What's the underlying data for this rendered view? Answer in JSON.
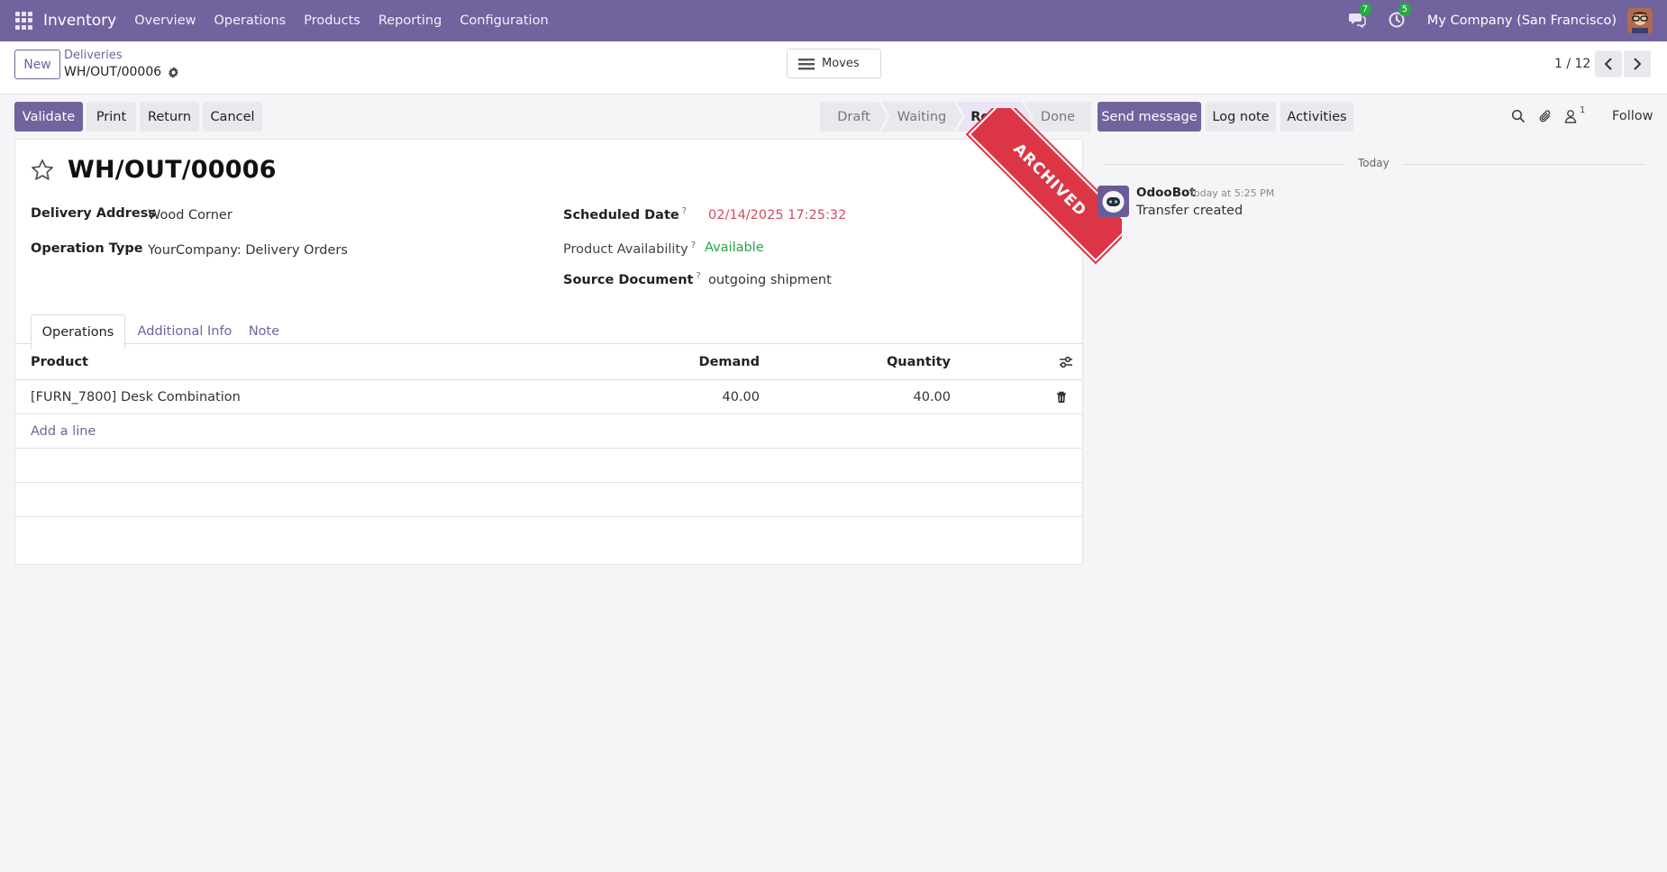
{
  "topbar": {
    "app_name": "Inventory",
    "nav": [
      "Overview",
      "Operations",
      "Products",
      "Reporting",
      "Configuration"
    ],
    "messages_badge": "7",
    "activities_badge": "5",
    "company": "My Company (San Francisco)"
  },
  "control": {
    "new_label": "New",
    "breadcrumb_parent": "Deliveries",
    "breadcrumb_current": "WH/OUT/00006",
    "moves_label": "Moves",
    "pager": "1 / 12"
  },
  "actions": {
    "validate": "Validate",
    "print": "Print",
    "return": "Return",
    "cancel": "Cancel"
  },
  "status": {
    "stages": [
      "Draft",
      "Waiting",
      "Ready",
      "Done"
    ],
    "active": "Ready"
  },
  "record": {
    "name": "WH/OUT/00006",
    "ribbon": "ARCHIVED",
    "fields": {
      "delivery_address_label": "Delivery Address",
      "delivery_address": "Wood Corner",
      "operation_type_label": "Operation Type",
      "operation_type": "YourCompany: Delivery Orders",
      "scheduled_date_label": "Scheduled Date",
      "scheduled_date": "02/14/2025 17:25:32",
      "availability_label": "Product Availability",
      "availability": "Available",
      "source_document_label": "Source Document",
      "source_document": "outgoing shipment",
      "help_mark": "?"
    }
  },
  "tabs": [
    "Operations",
    "Additional Info",
    "Note"
  ],
  "operations": {
    "columns": [
      "Product",
      "Demand",
      "Quantity"
    ],
    "rows": [
      {
        "product": "[FURN_7800] Desk Combination",
        "demand": "40.00",
        "quantity": "40.00"
      }
    ],
    "add_line": "Add a line"
  },
  "chatter": {
    "send_message": "Send message",
    "log_note": "Log note",
    "activities": "Activities",
    "followers_count": "1",
    "follow": "Follow",
    "date_separator": "Today",
    "messages": [
      {
        "author": "OdooBot",
        "time": "Today at 5:25 PM",
        "body": "Transfer created"
      }
    ]
  },
  "colors": {
    "brand": "#71639e",
    "danger": "#dc3545",
    "success": "#28a745"
  }
}
